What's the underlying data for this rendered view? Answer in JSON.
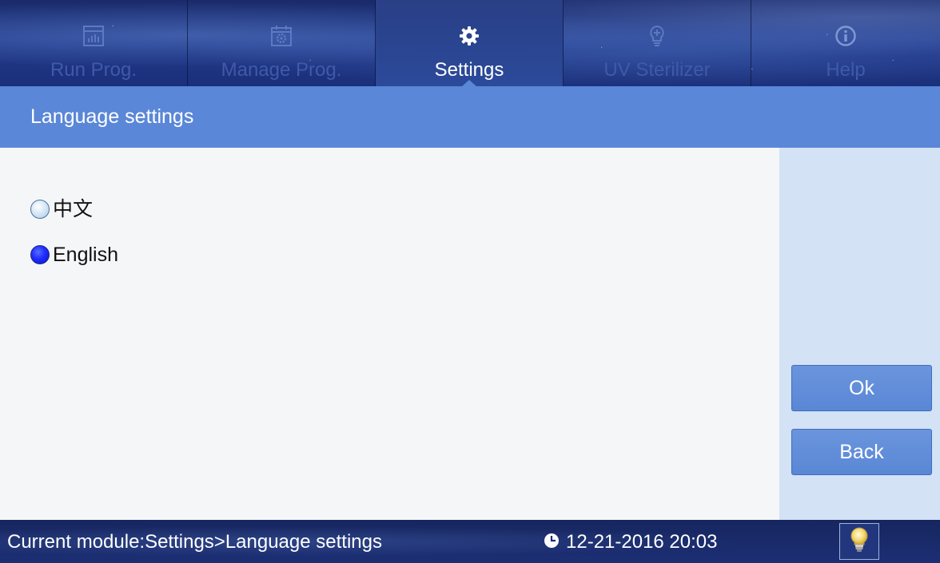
{
  "tabs": [
    {
      "label": "Run Prog.",
      "icon": "chart-icon",
      "active": false
    },
    {
      "label": "Manage Prog.",
      "icon": "calendar-gear-icon",
      "active": false
    },
    {
      "label": "Settings",
      "icon": "gear-icon",
      "active": true
    },
    {
      "label": "UV Sterilizer",
      "icon": "bulb-plus-icon",
      "active": false
    },
    {
      "label": "Help",
      "icon": "info-icon",
      "active": false
    }
  ],
  "section": {
    "title": "Language settings"
  },
  "language": {
    "options": [
      {
        "label": "中文",
        "checked": false
      },
      {
        "label": "English",
        "checked": true
      }
    ]
  },
  "buttons": {
    "ok": "Ok",
    "back": "Back"
  },
  "status": {
    "module": "Current module:Settings>Language settings",
    "datetime": "12-21-2016 20:03",
    "clock_icon": "clock-icon",
    "lamp_icon": "lightbulb-icon"
  },
  "colors": {
    "accent": "#5a87d7",
    "side_panel": "#d3e2f5",
    "radio_checked": "#1f2cff"
  }
}
